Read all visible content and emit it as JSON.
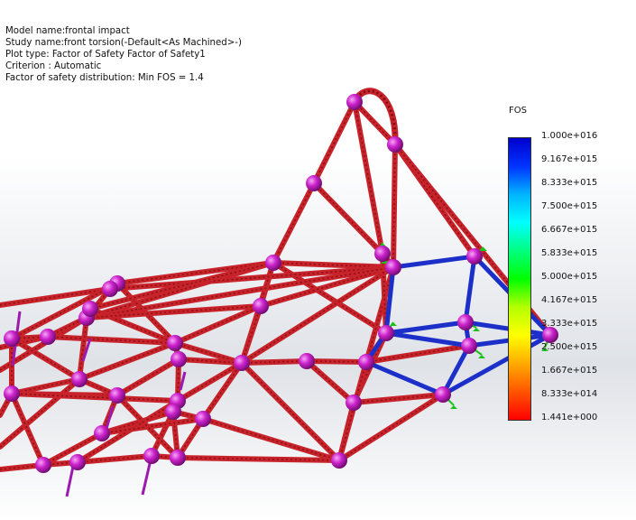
{
  "study_info": {
    "model_name": "Model name:frontal impact",
    "study_name": "Study name:front torsion(-Default<As Machined>-)",
    "plot_type": "Plot type: Factor of Safety Factor of Safety1",
    "criterion": "Criterion : Automatic",
    "distribution": "Factor of safety distribution: Min FOS =  1.4"
  },
  "legend": {
    "title": "FOS",
    "labels": [
      "1.000e+016",
      "9.167e+015",
      "8.333e+015",
      "7.500e+015",
      "6.667e+015",
      "5.833e+015",
      "5.000e+015",
      "4.167e+015",
      "3.333e+015",
      "2.500e+015",
      "1.667e+015",
      "8.333e+014",
      "1.441e+000"
    ],
    "stops": [
      "#0000cc",
      "#0033ff",
      "#00b4ff",
      "#00ffff",
      "#00ff80",
      "#00ff00",
      "#b4ff00",
      "#ffff00",
      "#ffaa00",
      "#ff5500",
      "#ff0000"
    ]
  },
  "colors": {
    "member_red": "#c8222a",
    "member_blue": "#1c2fc8",
    "node_magenta": "#cc22cc",
    "fixture_green": "#19c219",
    "load_purple": "#9a1ab0"
  },
  "icons": {
    "node": "joint-node-icon",
    "fixture": "fixture-arrow-icon",
    "load": "load-arrow-icon"
  }
}
